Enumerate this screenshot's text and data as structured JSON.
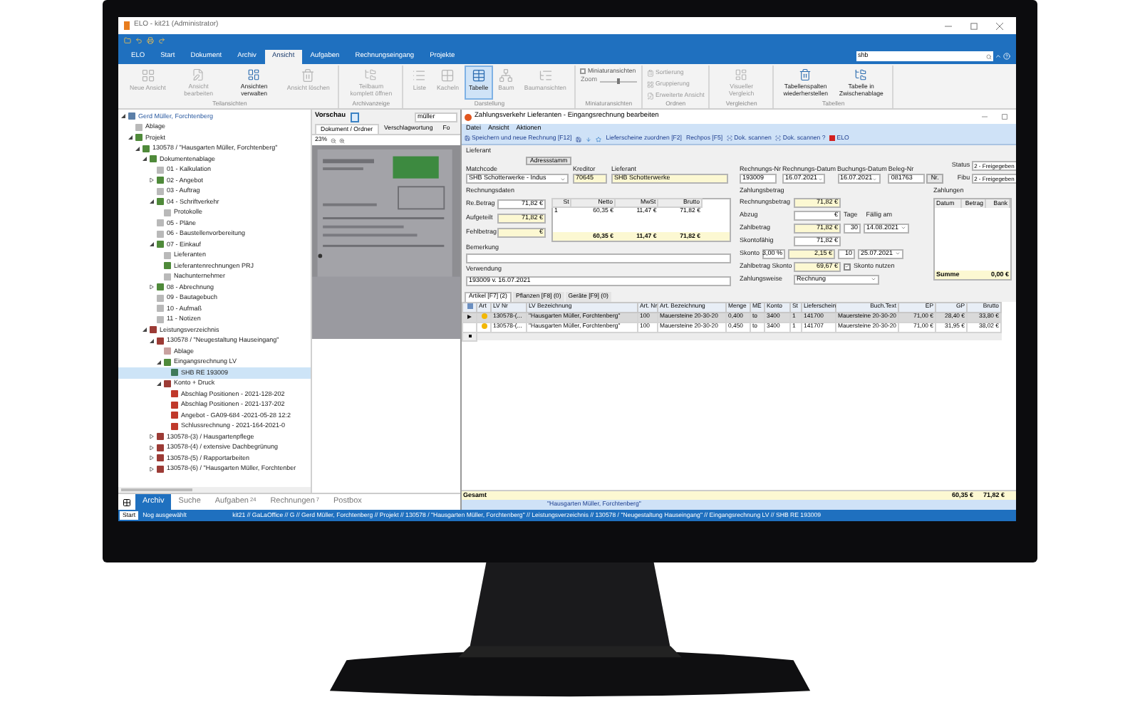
{
  "window": {
    "title": "ELO - kit21 (Administrator)"
  },
  "menu_tabs": [
    {
      "label": "ELO",
      "selected": false
    },
    {
      "label": "Start",
      "selected": false
    },
    {
      "label": "Dokument",
      "selected": false
    },
    {
      "label": "Archiv",
      "selected": false
    },
    {
      "label": "Ansicht",
      "selected": true
    },
    {
      "label": "Aufgaben",
      "selected": false
    },
    {
      "label": "Rechnungseingang",
      "selected": false
    },
    {
      "label": "Projekte",
      "selected": false
    }
  ],
  "search": {
    "value": "shb"
  },
  "ribbon": [
    {
      "label": "Teilansichten",
      "items": [
        {
          "kind": "large",
          "label": "Neue Ansicht",
          "disabled": true
        },
        {
          "kind": "large",
          "label": "Ansicht bearbeiten",
          "disabled": true
        },
        {
          "kind": "large",
          "label": "Ansichten verwalten",
          "disabled": false
        },
        {
          "kind": "large",
          "label": "Ansicht löschen",
          "disabled": true
        }
      ]
    },
    {
      "label": "Archivanzeige",
      "items": [
        {
          "kind": "large",
          "label": "Teilbaum komplett öffnen",
          "disabled": true
        }
      ]
    },
    {
      "label": "Darstellung",
      "items": [
        {
          "kind": "large",
          "label": "Liste",
          "disabled": true,
          "selected": false
        },
        {
          "kind": "large",
          "label": "Kacheln",
          "disabled": true,
          "selected": false
        },
        {
          "kind": "large",
          "label": "Tabelle",
          "disabled": false,
          "selected": true
        },
        {
          "kind": "large",
          "label": "Baum",
          "disabled": true,
          "selected": false
        },
        {
          "kind": "large",
          "label": "Baumansichten",
          "disabled": true,
          "selected": false
        }
      ]
    },
    {
      "label": "Miniaturansichten",
      "items": [
        {
          "kind": "check",
          "label": "Miniaturansichten",
          "checked": false
        },
        {
          "kind": "slider",
          "label": "Zoom",
          "level": 0.5
        }
      ]
    },
    {
      "label": "Ordnen",
      "items": [
        {
          "kind": "small",
          "label": "Sortierung",
          "disabled": true
        },
        {
          "kind": "small",
          "label": "Gruppierung",
          "disabled": true
        },
        {
          "kind": "small",
          "label": "Erweiterte Ansicht",
          "disabled": true
        }
      ]
    },
    {
      "label": "Vergleichen",
      "items": [
        {
          "kind": "large",
          "label": "Visueller Vergleich",
          "disabled": true
        }
      ]
    },
    {
      "label": "Tabellen",
      "items": [
        {
          "kind": "large",
          "label": "Tabellenspalten wiederherstellen",
          "disabled": false
        },
        {
          "kind": "large",
          "label": "Tabelle in Zwischenablage",
          "disabled": false
        }
      ]
    }
  ],
  "tree": {
    "items": [
      {
        "label": "Gerd Müller, Forchtenberg",
        "color": "#5b7fa8",
        "expanded": true,
        "selected": false,
        "children": [
          {
            "label": "Ablage",
            "color": "#b9b9b9",
            "selected": false
          },
          {
            "label": "Projekt",
            "color": "#4f8a3a",
            "expanded": true,
            "selected": false,
            "children": [
              {
                "label": "130578 / \"Hausgarten Müller, Forchtenberg\"",
                "color": "#4f8a3a",
                "expanded": true,
                "selected": false,
                "children": [
                  {
                    "label": "Dokumentenablage",
                    "color": "#4f8a3a",
                    "expanded": true,
                    "selected": false,
                    "children": [
                      {
                        "label": "01 - Kalkulation",
                        "color": "#b9b9b9",
                        "selected": false
                      },
                      {
                        "label": "02 - Angebot",
                        "color": "#4f8a3a",
                        "expanded": false,
                        "selected": false
                      },
                      {
                        "label": "03 - Auftrag",
                        "color": "#b9b9b9",
                        "selected": false
                      },
                      {
                        "label": "04 - Schriftverkehr",
                        "color": "#4f8a3a",
                        "expanded": true,
                        "selected": false,
                        "children": [
                          {
                            "label": "Protokolle",
                            "color": "#b9b9b9",
                            "selected": false
                          }
                        ]
                      },
                      {
                        "label": "05 - Pläne",
                        "color": "#b9b9b9",
                        "selected": false
                      },
                      {
                        "label": "06 - Baustellenvorbereitung",
                        "color": "#b9b9b9",
                        "selected": false
                      },
                      {
                        "label": "07 - Einkauf",
                        "color": "#4f8a3a",
                        "expanded": true,
                        "selected": false,
                        "children": [
                          {
                            "label": "Lieferanten",
                            "color": "#b9b9b9",
                            "selected": false
                          },
                          {
                            "label": "Lieferantenrechnungen PRJ",
                            "color": "#4f8a3a",
                            "selected": false
                          },
                          {
                            "label": "Nachunternehmer",
                            "color": "#b9b9b9",
                            "selected": false
                          }
                        ]
                      },
                      {
                        "label": "08 - Abrechnung",
                        "color": "#4f8a3a",
                        "expanded": false,
                        "selected": false
                      },
                      {
                        "label": "09 - Bautagebuch",
                        "color": "#b9b9b9",
                        "selected": false
                      },
                      {
                        "label": "10 - Aufmaß",
                        "color": "#b9b9b9",
                        "selected": false
                      },
                      {
                        "label": "11 - Notizen",
                        "color": "#b9b9b9",
                        "selected": false
                      }
                    ]
                  },
                  {
                    "label": "Leistungsverzeichnis",
                    "color": "#9c3b35",
                    "expanded": true,
                    "selected": false,
                    "children": [
                      {
                        "label": "130578 / \"Neugestaltung Hauseingang\"",
                        "color": "#9c3b35",
                        "expanded": true,
                        "selected": false,
                        "children": [
                          {
                            "label": "Ablage",
                            "color": "#c9a2a0",
                            "selected": false
                          },
                          {
                            "label": "Eingangsrechnung LV",
                            "color": "#4f8a3a",
                            "expanded": true,
                            "selected": false,
                            "children": [
                              {
                                "label": "SHB RE 193009",
                                "color": "#3f7a5a",
                                "selected": true
                              }
                            ]
                          },
                          {
                            "label": "Konto + Druck",
                            "color": "#9c3b35",
                            "expanded": true,
                            "selected": false,
                            "children": [
                              {
                                "label": "Abschlag Positionen - 2021-128-202",
                                "color": "#c0392b",
                                "selected": false
                              },
                              {
                                "label": "Abschlag Positionen - 2021-137-202",
                                "color": "#c0392b",
                                "selected": false
                              },
                              {
                                "label": "Angebot - GA09-684 -2021-05-28 12:2",
                                "color": "#c0392b",
                                "selected": false
                              },
                              {
                                "label": "Schlussrechnung - 2021-164-2021-0",
                                "color": "#c0392b",
                                "selected": false
                              }
                            ]
                          }
                        ]
                      },
                      {
                        "label": "130578-(3) / Hausgartenpflege",
                        "color": "#9c3b35",
                        "expanded": false,
                        "selected": false
                      },
                      {
                        "label": "130578-(4) / extensive Dachbegrünung",
                        "color": "#9c3b35",
                        "expanded": false,
                        "selected": false
                      },
                      {
                        "label": "130578-(5) / Rapportarbeiten",
                        "color": "#9c3b35",
                        "expanded": false,
                        "selected": false
                      },
                      {
                        "label": "130578-(6) / \"Hausgarten Müller, Forchtenber",
                        "color": "#9c3b35",
                        "expanded": false,
                        "selected": false
                      }
                    ]
                  }
                ]
              }
            ]
          }
        ]
      }
    ]
  },
  "preview": {
    "title": "Vorschau",
    "search": "müller",
    "tabs": [
      {
        "label": "Dokument / Ordner",
        "selected": true
      },
      {
        "label": "Verschlagwortung",
        "selected": false
      },
      {
        "label": "Fo",
        "selected": false
      }
    ],
    "zoom": "23%"
  },
  "bottom_tabs": [
    {
      "label": "Archiv",
      "selected": true
    },
    {
      "label": "Suche",
      "selected": false
    },
    {
      "label": "Aufgaben",
      "count": "24",
      "selected": false
    },
    {
      "label": "Rechnungen",
      "count": "7",
      "selected": false
    },
    {
      "label": "Postbox",
      "selected": false
    }
  ],
  "dialog": {
    "title": "Zahlungsverkehr Lieferanten - Eingangsrechnung bearbeiten",
    "menu": [
      "Datei",
      "Ansicht",
      "Aktionen"
    ],
    "toolbar": [
      "Speichern und neue Rechnung [F12]",
      "Lieferscheine zuordnen [F2]",
      "Rechpos [F5]",
      "Dok. scannen",
      "Dok. scannen ?",
      "ELO"
    ],
    "supplier": {
      "heading": "Lieferant",
      "address_button": "Adressstamm",
      "matchcode_label": "Matchcode",
      "matchcode": "SHB Schotterwerke - Indus",
      "creditor_label": "Kreditor",
      "creditor": "70645",
      "supplier_label": "Lieferant",
      "supplier": "SHB Schotterwerke"
    },
    "invoice_header": {
      "fields": [
        {
          "label": "Rechnungs-Nr",
          "value": "193009",
          "kind": "text"
        },
        {
          "label": "Rechnungs-Datum",
          "value": "16.07.2021",
          "kind": "date"
        },
        {
          "label": "Buchungs-Datum",
          "value": "16.07.2021",
          "kind": "date"
        },
        {
          "label": "Beleg-Nr",
          "value": "081763",
          "kind": "text"
        }
      ],
      "number_button": "Nr.",
      "status": [
        {
          "label": "Status",
          "value": "2 - Freigegeben"
        },
        {
          "label": "Fibu",
          "value": "2 - Freigegeben"
        }
      ]
    },
    "invoice_data": {
      "heading": "Rechnungsdaten",
      "fields": [
        {
          "label": "Re.Betrag",
          "value": "71,82 €",
          "highlight": false
        },
        {
          "label": "Aufgeteilt",
          "value": "71,82 €",
          "highlight": true
        },
        {
          "label": "Fehlbetrag",
          "value": "€",
          "highlight": true
        }
      ],
      "tax_table": {
        "columns": [
          "St",
          "Netto",
          "MwSt",
          "Brutto"
        ],
        "rows": [
          [
            "1",
            "60,35 €",
            "11,47 €",
            "71,82 €"
          ]
        ],
        "totals": [
          "60,35 €",
          "11,47 €",
          "71,82 €"
        ]
      },
      "remark_label": "Bemerkung",
      "usage_label": "Verwendung",
      "usage": "193009 v. 16.07.2021"
    },
    "payment": {
      "heading": "Zahlungsbetrag",
      "invoice_amount": {
        "label": "Rechnungsbetrag",
        "value": "71,82 €"
      },
      "deduction": {
        "label": "Abzug",
        "value": "€"
      },
      "days_label": "Tage",
      "days": "30",
      "due_label": "Fällig am",
      "due": "14.08.2021",
      "amount": {
        "label": "Zahlbetrag",
        "value": "71,82 €"
      },
      "discountable": {
        "label": "Skontofähig",
        "value": "71,82 €"
      },
      "discount": {
        "label": "Skonto",
        "percent": "3,00 %",
        "value": "2,15 €",
        "days": "10",
        "date": "25.07.2021"
      },
      "discount_amount": {
        "label": "Zahlbetrag Skonto",
        "value": "69,67 €"
      },
      "use_discount": {
        "label": "Skonto nutzen",
        "checked": true
      },
      "method": {
        "label": "Zahlungsweise",
        "value": "Rechnung"
      }
    },
    "payments": {
      "heading": "Zahlungen",
      "columns": [
        "Datum",
        "Betrag",
        "Bank"
      ],
      "sum_label": "Summe",
      "sum": "0,00 €"
    },
    "grid_tabs": [
      {
        "label": "Artikel [F7] (2)",
        "selected": true
      },
      {
        "label": "Pflanzen [F8] (0)",
        "selected": false
      },
      {
        "label": "Geräte [F9] (0)",
        "selected": false
      }
    ],
    "grid": {
      "icon_column": "Art",
      "columns": [
        "LV Nr",
        "LV Bezeichnung",
        "Art. Nr",
        "Art. Bezeichnung",
        "Menge",
        "ME",
        "Konto",
        "St",
        "Lieferschein",
        "Buch.Text",
        "EP",
        "GP",
        "Brutto"
      ],
      "rows": [
        {
          "selected": true,
          "cells": [
            "130578-(...",
            "\"Hausgarten Müller, Forchtenberg\"",
            "100",
            "Mauersteine 20-30-20",
            "0,400",
            "to",
            "3400",
            "1",
            "141700",
            "Mauersteine 20-30-20",
            "71,00 €",
            "28,40 €",
            "33,80 €"
          ]
        },
        {
          "selected": false,
          "cells": [
            "130578-(...",
            "\"Hausgarten Müller, Forchtenberg\"",
            "100",
            "Mauersteine 20-30-20",
            "0,450",
            "to",
            "3400",
            "1",
            "141707",
            "Mauersteine 20-30-20",
            "71,00 €",
            "31,95 €",
            "38,02 €"
          ]
        }
      ],
      "total_label": "Gesamt",
      "total_gp": "60,35 €",
      "total_brutto": "71,82 €"
    },
    "footer": "\"Hausgarten Müller, Forchtenberg\""
  },
  "status_bar": {
    "start": "Start",
    "selection": "Nog ausgewählt",
    "path": "kit21 // GaLaOffice // G // Gerd Müller, Forchtenberg // Projekt // 130578 / \"Hausgarten Müller, Forchtenberg\" // Leistungsverzeichnis // 130578 / \"Neugestaltung Hauseingang\" // Eingangsrechnung LV // SHB RE 193009"
  }
}
